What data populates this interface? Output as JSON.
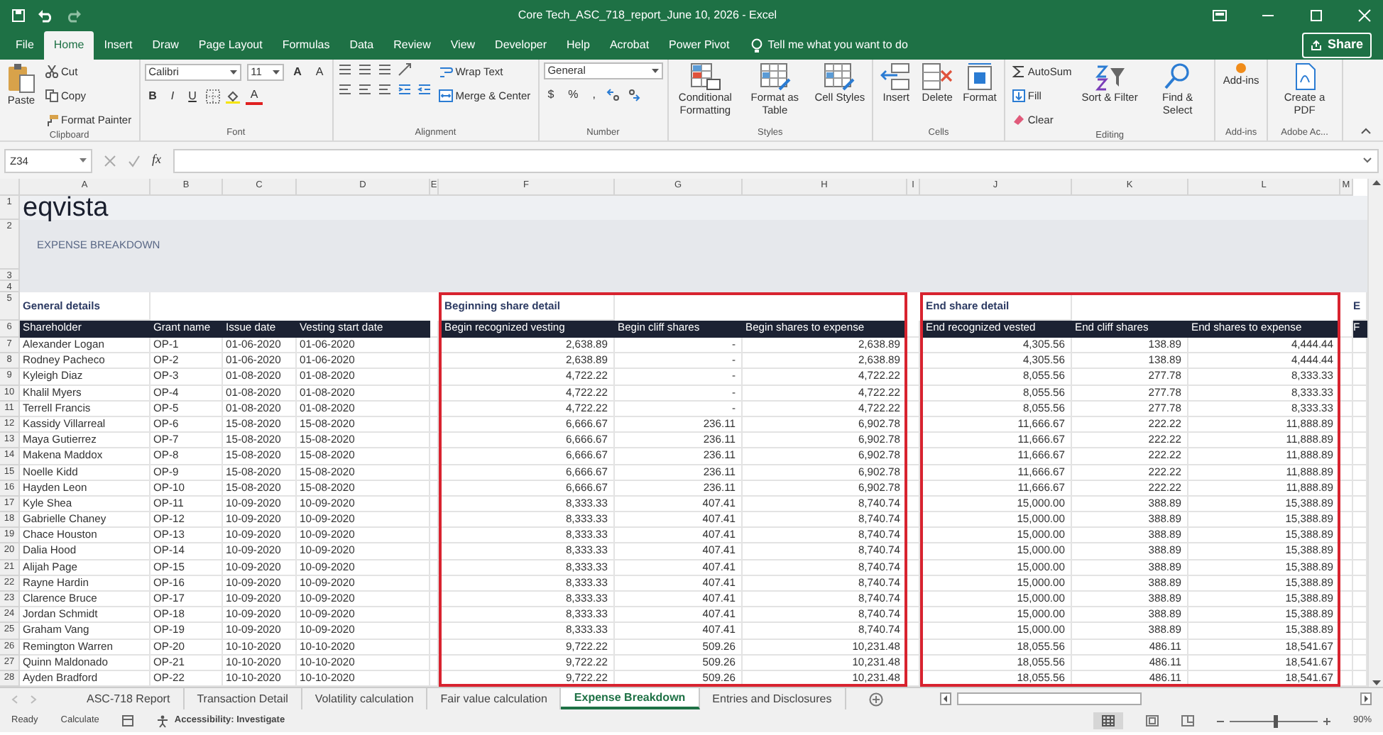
{
  "window": {
    "title": "Core Tech_ASC_718_report_June 10, 2026  -  Excel"
  },
  "menu_tabs": [
    {
      "label": "File",
      "selected": false
    },
    {
      "label": "Home",
      "selected": true
    },
    {
      "label": "Insert",
      "selected": false
    },
    {
      "label": "Draw",
      "selected": false
    },
    {
      "label": "Page Layout",
      "selected": false
    },
    {
      "label": "Formulas",
      "selected": false
    },
    {
      "label": "Data",
      "selected": false
    },
    {
      "label": "Review",
      "selected": false
    },
    {
      "label": "View",
      "selected": false
    },
    {
      "label": "Developer",
      "selected": false
    },
    {
      "label": "Help",
      "selected": false
    },
    {
      "label": "Acrobat",
      "selected": false
    },
    {
      "label": "Power Pivot",
      "selected": false
    }
  ],
  "tell_me": {
    "placeholder": "Tell me what you want to do"
  },
  "share_button": "Share",
  "ribbon": [
    {
      "label": "Clipboard",
      "items": [
        {
          "kind": "large",
          "label": "Paste"
        },
        {
          "kind": "small",
          "label": "Cut"
        },
        {
          "kind": "small",
          "label": "Copy"
        },
        {
          "kind": "small",
          "label": "Format Painter"
        }
      ]
    },
    {
      "label": "Font",
      "items": [
        {
          "kind": "field",
          "value": "Calibri"
        },
        {
          "kind": "field",
          "value": "11"
        },
        {
          "kind": "glyph",
          "label": "A"
        },
        {
          "kind": "glyph",
          "label": "A"
        },
        {
          "kind": "glyph",
          "label": "B"
        },
        {
          "kind": "glyph",
          "label": "I"
        },
        {
          "kind": "glyph",
          "label": "U"
        },
        {
          "kind": "glyph",
          "label": "A"
        }
      ]
    },
    {
      "label": "Alignment",
      "items": [
        {
          "kind": "small",
          "label": "Wrap Text"
        },
        {
          "kind": "small",
          "label": "Merge & Center"
        }
      ]
    },
    {
      "label": "Number",
      "items": [
        {
          "kind": "field",
          "value": "General"
        },
        {
          "kind": "glyph",
          "label": "$"
        },
        {
          "kind": "glyph",
          "label": "%"
        },
        {
          "kind": "glyph",
          "label": ","
        }
      ]
    },
    {
      "label": "Styles",
      "items": [
        {
          "kind": "large",
          "label": "Conditional Formatting"
        },
        {
          "kind": "large",
          "label": "Format as Table"
        },
        {
          "kind": "large",
          "label": "Cell Styles"
        }
      ]
    },
    {
      "label": "Cells",
      "items": [
        {
          "kind": "large",
          "label": "Insert"
        },
        {
          "kind": "large",
          "label": "Delete"
        },
        {
          "kind": "large",
          "label": "Format"
        }
      ]
    },
    {
      "label": "Editing",
      "items": [
        {
          "kind": "small",
          "label": "AutoSum"
        },
        {
          "kind": "small",
          "label": "Fill"
        },
        {
          "kind": "small",
          "label": "Clear"
        },
        {
          "kind": "large",
          "label": "Sort & Filter"
        },
        {
          "kind": "large",
          "label": "Find & Select"
        }
      ]
    },
    {
      "label": "Add-ins",
      "items": [
        {
          "kind": "large",
          "label": "Add-ins"
        }
      ]
    },
    {
      "label": "Adobe Ac...",
      "items": [
        {
          "kind": "large",
          "label": "Create a PDF"
        }
      ]
    }
  ],
  "formula_bar": {
    "name_box": "Z34",
    "function_label": "fx"
  },
  "sheet": {
    "columns": [
      "A",
      "B",
      "C",
      "D",
      "E",
      "F",
      "G",
      "H",
      "I",
      "J",
      "K",
      "L",
      "M"
    ],
    "top_row_numbers": [
      "1",
      "2",
      "3",
      "4",
      "5",
      "6"
    ],
    "logo": "eqvista",
    "title": "EXPENSE BREAKDOWN",
    "sections": [
      {
        "title": "General details",
        "columns": [
          "Shareholder",
          "Grant name",
          "Issue date",
          "Vesting start date"
        ]
      },
      {
        "title": "Beginning share  detail",
        "columns": [
          "Begin recognized vesting",
          "Begin cliff shares",
          "Begin shares to expense"
        ]
      },
      {
        "title": "End share detail",
        "columns": [
          "End recognized vested",
          "End cliff shares",
          "End shares to expense"
        ]
      },
      {
        "title": "E",
        "columns": [
          "F"
        ]
      }
    ],
    "rows": [
      {
        "number": "7",
        "cells": [
          "Alexander Logan",
          "OP-1",
          "01-06-2020",
          "01-06-2020",
          "2,638.89",
          "-",
          "2,638.89",
          "4,305.56",
          "138.89",
          "4,444.44"
        ]
      },
      {
        "number": "8",
        "cells": [
          "Rodney Pacheco",
          "OP-2",
          "01-06-2020",
          "01-06-2020",
          "2,638.89",
          "-",
          "2,638.89",
          "4,305.56",
          "138.89",
          "4,444.44"
        ]
      },
      {
        "number": "9",
        "cells": [
          "Kyleigh Diaz",
          "OP-3",
          "01-08-2020",
          "01-08-2020",
          "4,722.22",
          "-",
          "4,722.22",
          "8,055.56",
          "277.78",
          "8,333.33"
        ]
      },
      {
        "number": "10",
        "cells": [
          "Khalil Myers",
          "OP-4",
          "01-08-2020",
          "01-08-2020",
          "4,722.22",
          "-",
          "4,722.22",
          "8,055.56",
          "277.78",
          "8,333.33"
        ]
      },
      {
        "number": "11",
        "cells": [
          "Terrell Francis",
          "OP-5",
          "01-08-2020",
          "01-08-2020",
          "4,722.22",
          "-",
          "4,722.22",
          "8,055.56",
          "277.78",
          "8,333.33"
        ]
      },
      {
        "number": "12",
        "cells": [
          "Kassidy Villarreal",
          "OP-6",
          "15-08-2020",
          "15-08-2020",
          "6,666.67",
          "236.11",
          "6,902.78",
          "11,666.67",
          "222.22",
          "11,888.89"
        ]
      },
      {
        "number": "13",
        "cells": [
          "Maya Gutierrez",
          "OP-7",
          "15-08-2020",
          "15-08-2020",
          "6,666.67",
          "236.11",
          "6,902.78",
          "11,666.67",
          "222.22",
          "11,888.89"
        ]
      },
      {
        "number": "14",
        "cells": [
          "Makena Maddox",
          "OP-8",
          "15-08-2020",
          "15-08-2020",
          "6,666.67",
          "236.11",
          "6,902.78",
          "11,666.67",
          "222.22",
          "11,888.89"
        ]
      },
      {
        "number": "15",
        "cells": [
          "Noelle Kidd",
          "OP-9",
          "15-08-2020",
          "15-08-2020",
          "6,666.67",
          "236.11",
          "6,902.78",
          "11,666.67",
          "222.22",
          "11,888.89"
        ]
      },
      {
        "number": "16",
        "cells": [
          "Hayden Leon",
          "OP-10",
          "15-08-2020",
          "15-08-2020",
          "6,666.67",
          "236.11",
          "6,902.78",
          "11,666.67",
          "222.22",
          "11,888.89"
        ]
      },
      {
        "number": "17",
        "cells": [
          "Kyle Shea",
          "OP-11",
          "10-09-2020",
          "10-09-2020",
          "8,333.33",
          "407.41",
          "8,740.74",
          "15,000.00",
          "388.89",
          "15,388.89"
        ]
      },
      {
        "number": "18",
        "cells": [
          "Gabrielle Chaney",
          "OP-12",
          "10-09-2020",
          "10-09-2020",
          "8,333.33",
          "407.41",
          "8,740.74",
          "15,000.00",
          "388.89",
          "15,388.89"
        ]
      },
      {
        "number": "19",
        "cells": [
          "Chace Houston",
          "OP-13",
          "10-09-2020",
          "10-09-2020",
          "8,333.33",
          "407.41",
          "8,740.74",
          "15,000.00",
          "388.89",
          "15,388.89"
        ]
      },
      {
        "number": "20",
        "cells": [
          "Dalia Hood",
          "OP-14",
          "10-09-2020",
          "10-09-2020",
          "8,333.33",
          "407.41",
          "8,740.74",
          "15,000.00",
          "388.89",
          "15,388.89"
        ]
      },
      {
        "number": "21",
        "cells": [
          "Alijah Page",
          "OP-15",
          "10-09-2020",
          "10-09-2020",
          "8,333.33",
          "407.41",
          "8,740.74",
          "15,000.00",
          "388.89",
          "15,388.89"
        ]
      },
      {
        "number": "22",
        "cells": [
          "Rayne Hardin",
          "OP-16",
          "10-09-2020",
          "10-09-2020",
          "8,333.33",
          "407.41",
          "8,740.74",
          "15,000.00",
          "388.89",
          "15,388.89"
        ]
      },
      {
        "number": "23",
        "cells": [
          "Clarence Bruce",
          "OP-17",
          "10-09-2020",
          "10-09-2020",
          "8,333.33",
          "407.41",
          "8,740.74",
          "15,000.00",
          "388.89",
          "15,388.89"
        ]
      },
      {
        "number": "24",
        "cells": [
          "Jordan Schmidt",
          "OP-18",
          "10-09-2020",
          "10-09-2020",
          "8,333.33",
          "407.41",
          "8,740.74",
          "15,000.00",
          "388.89",
          "15,388.89"
        ]
      },
      {
        "number": "25",
        "cells": [
          "Graham Vang",
          "OP-19",
          "10-09-2020",
          "10-09-2020",
          "8,333.33",
          "407.41",
          "8,740.74",
          "15,000.00",
          "388.89",
          "15,388.89"
        ]
      },
      {
        "number": "26",
        "cells": [
          "Remington Warren",
          "OP-20",
          "10-10-2020",
          "10-10-2020",
          "9,722.22",
          "509.26",
          "10,231.48",
          "18,055.56",
          "486.11",
          "18,541.67"
        ]
      },
      {
        "number": "27",
        "cells": [
          "Quinn Maldonado",
          "OP-21",
          "10-10-2020",
          "10-10-2020",
          "9,722.22",
          "509.26",
          "10,231.48",
          "18,055.56",
          "486.11",
          "18,541.67"
        ]
      },
      {
        "number": "28",
        "cells": [
          "Ayden Bradford",
          "OP-22",
          "10-10-2020",
          "10-10-2020",
          "9,722.22",
          "509.26",
          "10,231.48",
          "18,055.56",
          "486.11",
          "18,541.67"
        ]
      }
    ]
  },
  "sheet_tabs": [
    {
      "label": "ASC-718 Report",
      "selected": false
    },
    {
      "label": "Transaction Detail",
      "selected": false
    },
    {
      "label": "Volatility calculation",
      "selected": false
    },
    {
      "label": "Fair value calculation",
      "selected": false
    },
    {
      "label": "Expense Breakdown",
      "selected": true
    },
    {
      "label": "Entries and Disclosures",
      "selected": false
    }
  ],
  "status_bar": {
    "items": [
      "Ready",
      "Calculate"
    ],
    "accessibility": "Accessibility: Investigate",
    "zoom": {
      "level": 0.5,
      "reading": "90%"
    }
  }
}
